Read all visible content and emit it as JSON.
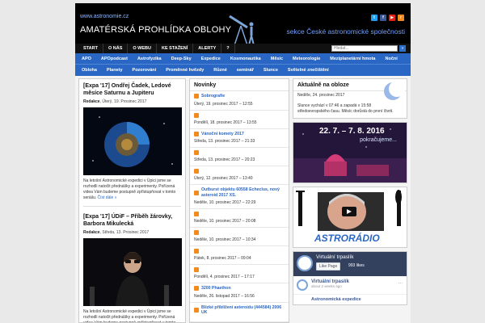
{
  "header": {
    "url": "www.astronomie.cz",
    "title": "AMATÉRSKÁ PROHLÍDKA OBLOHY",
    "subtitle": "sekce České astronomické společnosti",
    "socials": [
      {
        "icon": "twitter-icon",
        "label": "t",
        "color": "#1da1f2"
      },
      {
        "icon": "facebook-icon",
        "label": "f",
        "color": "#3b5998"
      },
      {
        "icon": "youtube-icon",
        "label": "▶",
        "color": "#e62117"
      },
      {
        "icon": "rss-icon",
        "label": "r",
        "color": "#f28a1e"
      }
    ]
  },
  "topnav": [
    "START",
    "O NÁS",
    "O WEBU",
    "KE STAŽENÍ",
    "ALERTY",
    "?"
  ],
  "search": {
    "placeholder": "Hledat...",
    "button": "»"
  },
  "catnav": {
    "row1": [
      "APO",
      "APOpodcast",
      "Astrofyzika",
      "Deep-Sky",
      "Expedice",
      "Kosmonautika",
      "Měsíc",
      "Meteorologie",
      "Meziplanetární hmota",
      "Noční"
    ],
    "row2": [
      "Obloha",
      "Planety",
      "Pozorování",
      "Proměnné hvězdy",
      "Různé",
      "seminář",
      "Slunce",
      "Světelné znečištění"
    ]
  },
  "posts": [
    {
      "title": "[Expa '17] Ondřej Čadek, Ledové měsíce Saturnu a Jupiteru",
      "author": "Redakce",
      "date": ", Úterý, 19. Prosinec 2017",
      "text": "Na letošní Astronomické expedici v Úpici jsme se rozhodli natočit přednášky a experimenty. Pořízená videa Vám budeme postupně zpřístupňovat v tomto seriálu.",
      "more": "Číst dále »"
    },
    {
      "title": "[Expa '17] ÚDiF – Příběh žárovky, Barbora Mikulecká",
      "author": "Redakce",
      "date": ", Středa, 13. Prosinec 2017",
      "text": "Na letošní Astronomické expedici v Úpici jsme se rozhodli natočit přednášky a experimenty. Pořízená videa Vám budeme postupně zpřístupňovat v tomto seriálu."
    }
  ],
  "news": {
    "heading": "Novinky",
    "items": [
      {
        "title": "Sobrografie",
        "date": "Úterý, 19. prosinec 2017 – 12:55"
      },
      {
        "title": "",
        "date": "Pondělí, 18. prosinec 2017 – 13:55"
      },
      {
        "title": "Vánoční komety 2017",
        "date": "Středa, 13. prosinec 2017 – 21:33"
      },
      {
        "title": "",
        "date": "Středa, 13. prosinec 2017 – 20:23"
      },
      {
        "title": "",
        "date": "Úterý, 12. prosinec 2017 – 13:40"
      },
      {
        "title": "Outburst objektu 60558 Echeclus, nový asteroid 2017 XS.",
        "date": "Neděle, 10. prosinec 2017 – 22:29"
      },
      {
        "title": "",
        "date": "Neděle, 10. prosinec 2017 – 20:08"
      },
      {
        "title": "",
        "date": "Neděle, 10. prosinec 2017 – 10:34"
      },
      {
        "title": "",
        "date": "Pátek, 8. prosinec 2017 – 09:04"
      },
      {
        "title": "",
        "date": "Pondělí, 4. prosinec 2017 – 17:17"
      },
      {
        "title": "3200 Phaethon",
        "date": "Neděle, 26. listopad 2017 – 16:56"
      },
      {
        "title": "Blízké přiblížení asteroidu (444584) 2006 UK",
        "date": ""
      }
    ]
  },
  "sky": {
    "heading": "Aktuálně na obloze",
    "date": "Neděle, 24. prosinec 2017",
    "text": "Slunce vychází v 07:46 a zapadá v 15:58 středoevropského času. Měsíc dorůstá do první čtvrti."
  },
  "banner": {
    "dates": "22. 7. – 7. 8. 2016",
    "caption": "pokračujeme..."
  },
  "radio": {
    "title": "ASTRORÁDIO"
  },
  "facebook": {
    "page_name": "Virtuální trpaslík",
    "like_label": "Like Page",
    "likes": "993 likes",
    "post_name": "Virtuální trpaslík",
    "post_ago": "about 2 weeks ago",
    "next_name": "Astronomická expedice"
  }
}
